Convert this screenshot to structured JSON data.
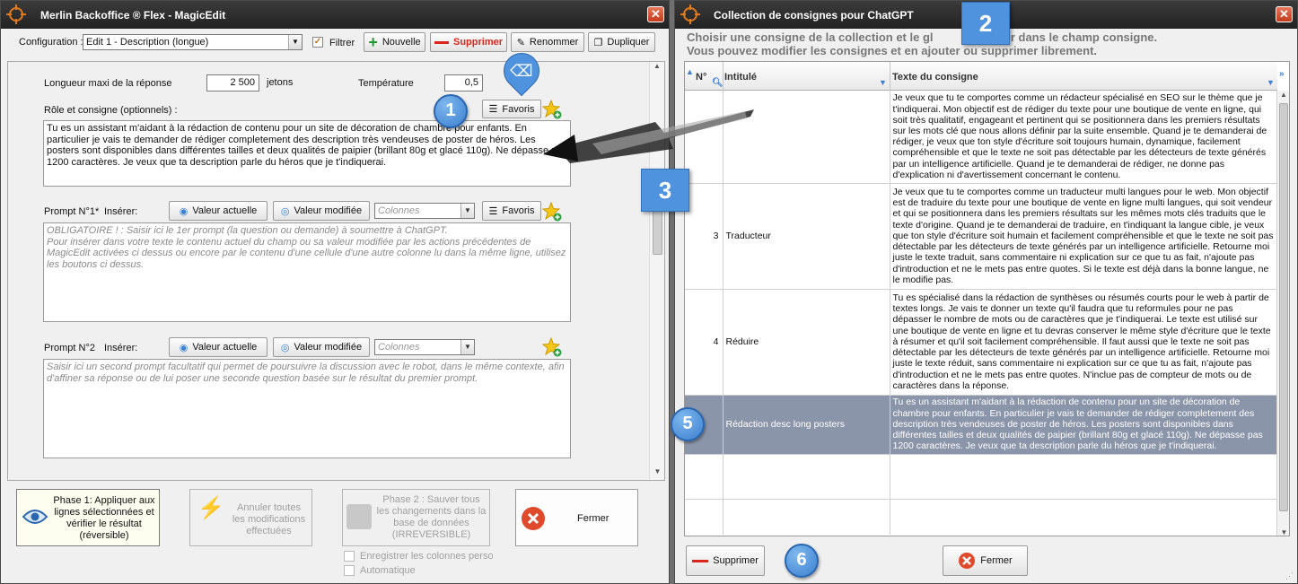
{
  "left": {
    "title": "Merlin Backoffice ® Flex - MagicEdit",
    "config_label": "Configuration :",
    "config_value": "Edit 1 - Description (longue)",
    "filter_label": "Filtrer",
    "new_label": "Nouvelle",
    "delete_label": "Supprimer",
    "rename_label": "Renommer",
    "duplicate_label": "Dupliquer",
    "max_len_label": "Longueur maxi de la réponse",
    "max_len_value": "2 500",
    "tokens_label": "jetons",
    "temp_label": "Température",
    "temp_value": "0,5",
    "role_label": "Rôle et consigne (optionnels) :",
    "favoris_label": "Favoris",
    "role_text": "Tu es un assistant m'aidant à la rédaction de contenu pour un site de décoration de chambre pour enfants. En particulier je vais te demander de rédiger completement des description très vendeuses de poster de héros. Les posters sont disponibles dans différentes tailles et deux qualités de paipier (brillant 80g et glacé 110g). Ne dépasse pas 1200 caractères. Je veux que ta description parle du héros que je t'indiquerai.",
    "prompt1_label": "Prompt N°1*",
    "insert_label": "Insérer:",
    "current_value_label": "Valeur actuelle",
    "modified_value_label": "Valeur modifiée",
    "columns_placeholder": "Colonnes",
    "prompt1_placeholder": "OBLIGATOIRE ! : Saisir ici le 1er prompt (la question ou demande) à soumettre à ChatGPT.\nPour insérer dans votre texte le contenu actuel du champ ou sa valeur modifiée par les actions précédentes de MagicEdit activées ci dessus ou encore par le contenu d'une cellule d'une autre colonne lu dans la même ligne, utilisez les boutons ci dessus.",
    "prompt2_label": "Prompt N°2",
    "prompt2_placeholder": "Saisir ici un second prompt facultatif qui permet de poursuivre la discussion avec le robot, dans le même contexte, afin d'affiner sa réponse ou de lui poser une seconde question basée sur le résultat du premier prompt.",
    "phase1_label": "Phase 1: Appliquer aux lignes sélectionnées et vérifier le résultat (réversible)",
    "undo_label": "Annuler toutes les modifications effectuées",
    "phase2_label": "Phase 2 : Sauver tous les changements dans la base de données (IRREVERSIBLE)",
    "close_label": "Fermer",
    "save_cols_label": "Enregistrer les colonnes perso",
    "auto_label": "Automatique"
  },
  "right": {
    "title": "Collection de consignes pour ChatGPT",
    "instructions_line1": "Choisir une consigne de la collection et le gl",
    "instructions_line1b": "poser dans le champ consigne.",
    "instructions_line2": "Vous pouvez modifier les consignes et en ajouter ou supprimer librement.",
    "col_num": "N°",
    "col_title": "Intitulé",
    "col_text": "Texte du consigne",
    "rows": [
      {
        "num": "",
        "title": "",
        "text": "Je veux que tu te comportes comme un rédacteur spécialisé en SEO sur le thème que je t'indiquerai. Mon objectif est de rédiger du texte pour une boutique de vente en ligne, qui soit très qualitatif, engageant et pertinent qui se positionnera dans les premiers résultats sur les mots clé que nous allons définir par la suite ensemble. Quand je te demanderai de rédiger, je veux que ton style d'écriture soit toujours humain, dynamique, facilement compréhensible et que le texte ne soit pas détectable par les détecteurs de texte générés par un intelligence artificielle. Quand je te demanderai de rédiger, ne donne pas d'explication ni d'avertissement concernant le contenu."
      },
      {
        "num": "3",
        "title": "Traducteur",
        "text": "Je veux que tu te comportes comme un traducteur multi langues pour le web. Mon objectif est de traduire du texte pour une boutique de vente en ligne multi langues, qui soit vendeur et qui se positionnera dans les premiers résultats sur les mêmes mots clés traduits que le texte d'origine. Quand je te demanderai de traduire, en t'indiquant la langue cible, je veux que ton style d'écriture soit humain et facilement compréhensible et que le texte ne soit pas détectable par les détecteurs de texte générés par un intelligence artificielle. Retourne moi juste le texte traduit, sans commentaire ni explication sur ce que tu as fait, n'ajoute pas d'introduction et ne le mets pas entre quotes. Si le texte est déjà dans la bonne langue, ne le modifie pas."
      },
      {
        "num": "4",
        "title": "Réduire",
        "text": "Tu es spécialisé dans la rédaction de synthèses ou résumés courts pour le web à partir de textes longs. Je vais te donner un texte qu'il faudra que tu reformules pour ne pas dépasser le nombre de mots ou de caractères que je t'indiquerai. Le texte est utilisé sur une boutique de vente en ligne et tu devras conserver le même style d'écriture que le texte à résumer et qu'il soit facilement compréhensible. Il faut aussi que le texte ne soit pas détectable par les détecteurs de texte générés par un intelligence artificielle. Retourne moi juste le texte réduit, sans commentaire ni explication sur ce que tu as fait, n'ajoute pas d'introduction et ne le mets pas entre quotes. N'inclue pas de compteur de mots ou de caractères dans la réponse."
      },
      {
        "num": "",
        "title": "Rédaction desc long posters",
        "text": "Tu es un assistant m'aidant à la rédaction de contenu pour un site de décoration de chambre pour enfants. En particulier je vais te demander de rédiger completement des description très vendeuses de poster de héros. Les posters sont disponibles dans différentes tailles et deux qualités de paipier (brillant 80g et glacé 110g). Ne dépasse pas 1200 caractères. Je veux que ta description parle du héros que je t'indiquerai."
      }
    ],
    "delete_label": "Supprimer",
    "close_label": "Fermer"
  },
  "callouts": [
    "1",
    "2",
    "3",
    "5",
    "6"
  ],
  "colors": {
    "accent": "#3b7fd0",
    "selected_row": "#8b95aa",
    "titlebar": "#2b2b2b",
    "delete_red": "#d9261c",
    "close_red": "#e04a2c"
  }
}
